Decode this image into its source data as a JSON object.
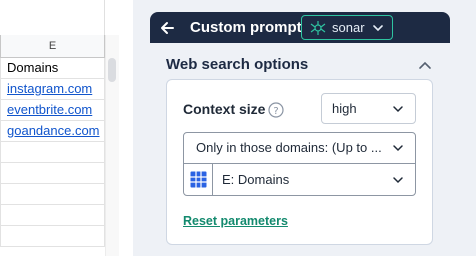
{
  "sheet": {
    "column_header": "E",
    "rows": [
      {
        "value": "Domains",
        "link": false
      },
      {
        "value": "instagram.com",
        "link": true
      },
      {
        "value": "eventbrite.com",
        "link": true
      },
      {
        "value": "goandance.com",
        "link": true
      },
      {
        "value": "",
        "link": false
      },
      {
        "value": "",
        "link": false
      },
      {
        "value": "",
        "link": false
      },
      {
        "value": "",
        "link": false
      },
      {
        "value": "",
        "link": false
      }
    ]
  },
  "panel": {
    "title": "Custom prompt",
    "model": {
      "label": "sonar",
      "icon": "spider-icon"
    },
    "section_title": "Web search options",
    "context_size": {
      "label": "Context size",
      "value": "high"
    },
    "domain_mode": {
      "value": "Only in those domains: (Up to ..."
    },
    "domain_column": {
      "value": "E: Domains",
      "icon": "grid-icon"
    },
    "reset_label": "Reset parameters"
  },
  "colors": {
    "topbar": "#1d2a43",
    "accent": "#2fc4a1",
    "link": "#138a6e",
    "sheet_link": "#1155cc",
    "panel_bg": "#eef1f6"
  }
}
